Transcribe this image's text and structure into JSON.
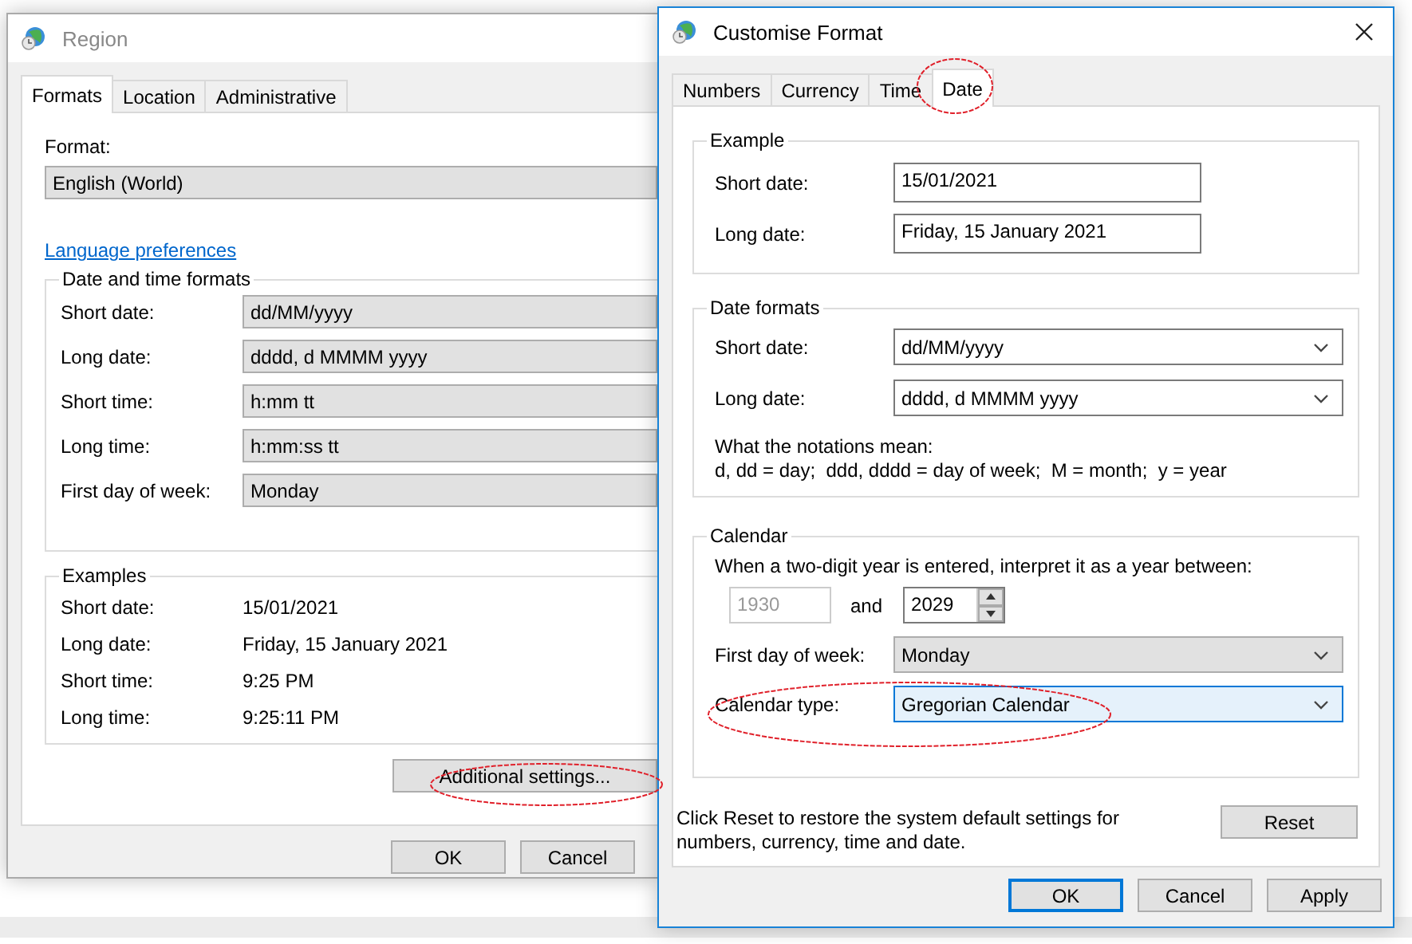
{
  "region_window": {
    "title": "Region",
    "active": false,
    "tabs": [
      {
        "label": "Formats",
        "selected": true
      },
      {
        "label": "Location",
        "selected": false
      },
      {
        "label": "Administrative",
        "selected": false
      }
    ],
    "format_label": "Format:",
    "format_value": "English (World)",
    "link": "Language preferences",
    "formats_group": {
      "title": "Date and time formats",
      "rows": [
        {
          "label": "Short date:",
          "value": "dd/MM/yyyy"
        },
        {
          "label": "Long date:",
          "value": "dddd, d MMMM yyyy"
        },
        {
          "label": "Short time:",
          "value": "h:mm tt"
        },
        {
          "label": "Long time:",
          "value": "h:mm:ss tt"
        },
        {
          "label": "First day of week:",
          "value": "Monday"
        }
      ]
    },
    "examples_group": {
      "title": "Examples",
      "rows": [
        {
          "label": "Short date:",
          "value": "15/01/2021"
        },
        {
          "label": "Long date:",
          "value": "Friday, 15 January 2021"
        },
        {
          "label": "Short time:",
          "value": "9:25 PM"
        },
        {
          "label": "Long time:",
          "value": "9:25:11 PM"
        }
      ]
    },
    "additional_button": "Additional settings...",
    "buttons": [
      "OK",
      "Cancel"
    ]
  },
  "customise_window": {
    "title": "Customise Format",
    "active": true,
    "tabs": [
      {
        "label": "Numbers",
        "selected": false
      },
      {
        "label": "Currency",
        "selected": false
      },
      {
        "label": "Time",
        "selected": false
      },
      {
        "label": "Date",
        "selected": true
      }
    ],
    "example_group": {
      "title": "Example",
      "rows": [
        {
          "label": "Short date:",
          "value": "15/01/2021"
        },
        {
          "label": "Long date:",
          "value": "Friday, 15 January 2021"
        }
      ]
    },
    "date_formats_group": {
      "title": "Date formats",
      "rows": [
        {
          "label": "Short date:",
          "value": "dd/MM/yyyy",
          "editable": true,
          "focused": false
        },
        {
          "label": "Long date:",
          "value": "dddd, d MMMM yyyy",
          "editable": true,
          "focused": false
        }
      ],
      "notations_title": "What the notations mean:",
      "notations": "d, dd = day;  ddd, dddd = day of week;  M = month;  y = year"
    },
    "calendar_group": {
      "title": "Calendar",
      "prompt": "When a two-digit year is entered, interpret it as a year between:",
      "year_from": {
        "value": "1930",
        "disabled": true
      },
      "and_label": "and",
      "year_to": {
        "value": "2029",
        "disabled": false
      },
      "rows": [
        {
          "label": "First day of week:",
          "value": "Monday",
          "editable": false,
          "focused": false
        },
        {
          "label": "Calendar type:",
          "value": "Gregorian Calendar",
          "editable": false,
          "focused": true
        }
      ]
    },
    "reset_note": "Click Reset to restore the system default settings for numbers, currency, time and date.",
    "reset_button": "Reset",
    "buttons": [
      {
        "label": "OK",
        "default": true
      },
      {
        "label": "Cancel",
        "default": false
      },
      {
        "label": "Apply",
        "default": false
      }
    ]
  }
}
